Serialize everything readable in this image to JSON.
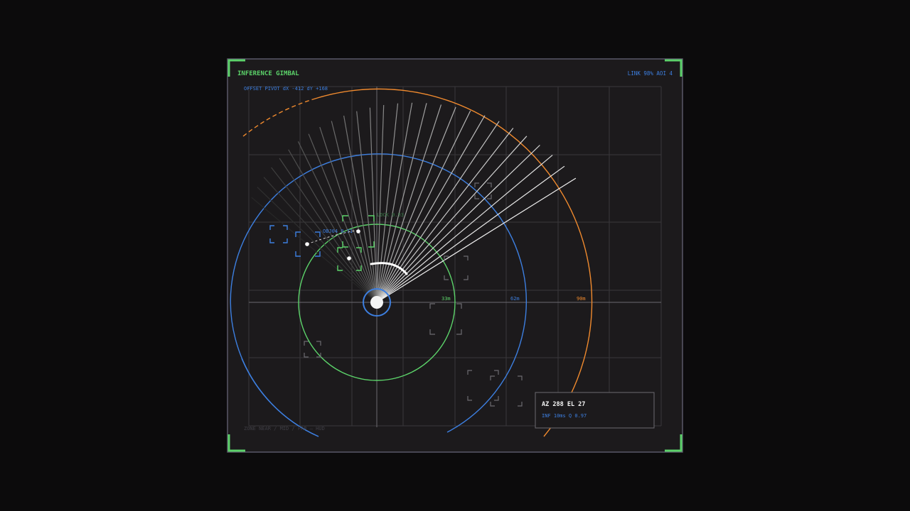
{
  "header": {
    "title": "INFERENCE GIMBAL",
    "status": "LINK 98%  AOI 4",
    "offset": "OFFSET PIVOT  dX -412  dY +168"
  },
  "rings": {
    "near": "33m",
    "mid": "62m",
    "far": "90m"
  },
  "targets": {
    "obj04": "OBJ04 0.71",
    "locked": "LOCK 0.93"
  },
  "readout": {
    "az_el": "AZ 288  EL 27",
    "inference": "INF 10ms  Q 0.97"
  },
  "footer": {
    "zones": "ZONE NEAR / MID / FAR — HUD"
  },
  "colors": {
    "accent_green": "#5cd36a",
    "accent_blue": "#3d7fe0",
    "accent_orange": "#f08a2e",
    "panel": "#1c1a1c",
    "grid": "#3a383b"
  }
}
